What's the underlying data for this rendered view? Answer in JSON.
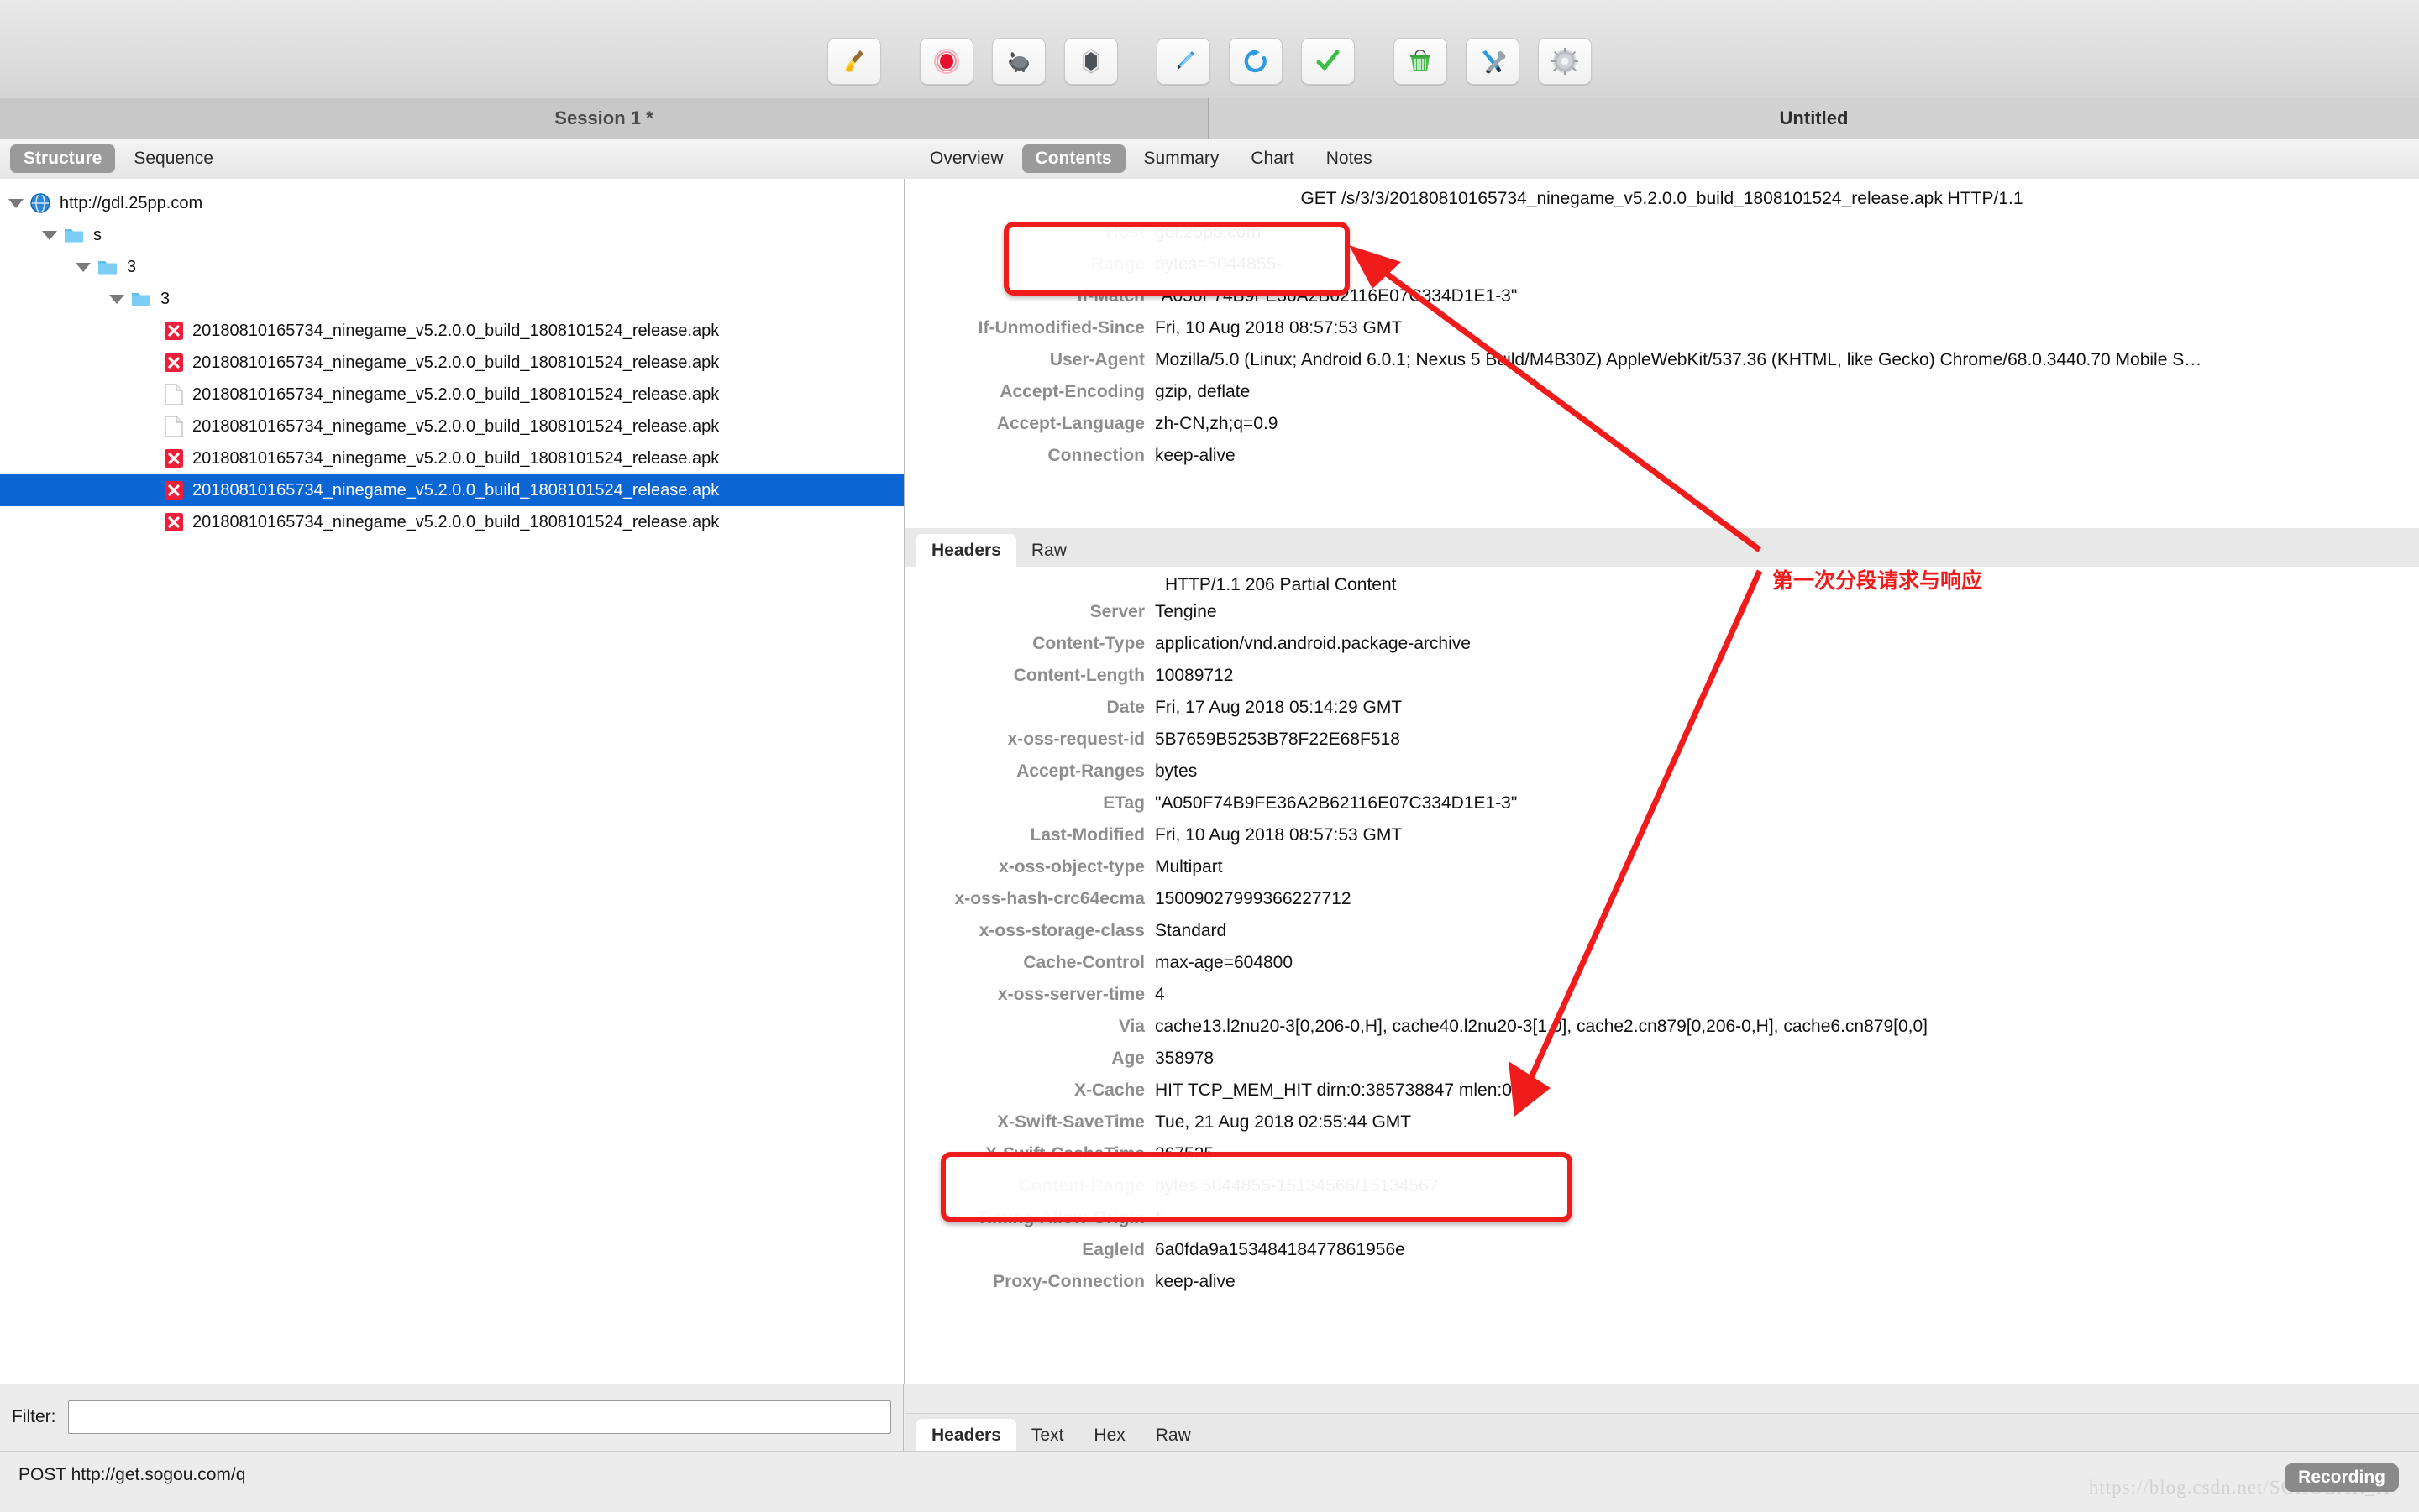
{
  "toolbar": {
    "buttons": [
      {
        "name": "clear-session-button",
        "icon": "broom-icon"
      },
      {
        "name": "record-button",
        "icon": "record-icon"
      },
      {
        "name": "throttle-button",
        "icon": "turtle-icon"
      },
      {
        "name": "breakpoints-button",
        "icon": "hexagon-icon"
      },
      {
        "name": "compose-button",
        "icon": "pen-icon"
      },
      {
        "name": "repeat-button",
        "icon": "refresh-icon"
      },
      {
        "name": "validate-button",
        "icon": "checkmark-icon"
      },
      {
        "name": "tools-basket-button",
        "icon": "trash-basket-icon"
      },
      {
        "name": "tools-button",
        "icon": "wrench-screwdriver-icon"
      },
      {
        "name": "settings-button",
        "icon": "gear-icon"
      }
    ]
  },
  "titles": {
    "session": "Session 1 *",
    "document": "Untitled"
  },
  "left_tabs": [
    {
      "label": "Structure",
      "active": true
    },
    {
      "label": "Sequence",
      "active": false
    }
  ],
  "right_tabs": [
    {
      "label": "Overview",
      "active": false
    },
    {
      "label": "Contents",
      "active": true
    },
    {
      "label": "Summary",
      "active": false
    },
    {
      "label": "Chart",
      "active": false
    },
    {
      "label": "Notes",
      "active": false
    }
  ],
  "tree": [
    {
      "label": "http://gdl.25pp.com",
      "depth": 0,
      "icon": "globe-icon",
      "expanded": true,
      "selected": false
    },
    {
      "label": "s",
      "depth": 1,
      "icon": "folder-icon",
      "expanded": true,
      "selected": false
    },
    {
      "label": "3",
      "depth": 2,
      "icon": "folder-icon",
      "expanded": true,
      "selected": false
    },
    {
      "label": "3",
      "depth": 3,
      "icon": "folder-icon",
      "expanded": true,
      "selected": false
    },
    {
      "label": "20180810165734_ninegame_v5.2.0.0_build_1808101524_release.apk",
      "depth": 4,
      "icon": "error-icon",
      "expanded": false,
      "selected": false
    },
    {
      "label": "20180810165734_ninegame_v5.2.0.0_build_1808101524_release.apk",
      "depth": 4,
      "icon": "error-icon",
      "expanded": false,
      "selected": false
    },
    {
      "label": "20180810165734_ninegame_v5.2.0.0_build_1808101524_release.apk",
      "depth": 4,
      "icon": "file-icon",
      "expanded": false,
      "selected": false
    },
    {
      "label": "20180810165734_ninegame_v5.2.0.0_build_1808101524_release.apk",
      "depth": 4,
      "icon": "file-icon",
      "expanded": false,
      "selected": false
    },
    {
      "label": "20180810165734_ninegame_v5.2.0.0_build_1808101524_release.apk",
      "depth": 4,
      "icon": "error-icon",
      "expanded": false,
      "selected": false
    },
    {
      "label": "20180810165734_ninegame_v5.2.0.0_build_1808101524_release.apk",
      "depth": 4,
      "icon": "error-icon",
      "expanded": false,
      "selected": true
    },
    {
      "label": "20180810165734_ninegame_v5.2.0.0_build_1808101524_release.apk",
      "depth": 4,
      "icon": "error-icon",
      "expanded": false,
      "selected": false
    }
  ],
  "filter": {
    "label": "Filter:",
    "value": "",
    "placeholder": ""
  },
  "request": {
    "line": "GET /s/3/3/20180810165734_ninegame_v5.2.0.0_build_1808101524_release.apk HTTP/1.1",
    "headers": [
      {
        "key": "Host",
        "value": "gdl.25pp.com"
      },
      {
        "key": "Range",
        "value": "bytes=5044855-"
      },
      {
        "key": "If-Match",
        "value": "\"A050F74B9FE36A2B62116E07C334D1E1-3\""
      },
      {
        "key": "If-Unmodified-Since",
        "value": "Fri, 10 Aug 2018 08:57:53 GMT"
      },
      {
        "key": "User-Agent",
        "value": "Mozilla/5.0 (Linux; Android 6.0.1; Nexus 5 Build/M4B30Z) AppleWebKit/537.36 (KHTML, like Gecko) Chrome/68.0.3440.70 Mobile S…"
      },
      {
        "key": "Accept-Encoding",
        "value": "gzip, deflate"
      },
      {
        "key": "Accept-Language",
        "value": "zh-CN,zh;q=0.9"
      },
      {
        "key": "Connection",
        "value": "keep-alive"
      }
    ]
  },
  "response_tabs": [
    {
      "label": "Headers",
      "active": true
    },
    {
      "label": "Raw",
      "active": false
    }
  ],
  "response": {
    "status_line": "HTTP/1.1 206 Partial Content",
    "headers": [
      {
        "key": "Server",
        "value": "Tengine"
      },
      {
        "key": "Content-Type",
        "value": "application/vnd.android.package-archive"
      },
      {
        "key": "Content-Length",
        "value": "10089712"
      },
      {
        "key": "Date",
        "value": "Fri, 17 Aug 2018 05:14:29 GMT"
      },
      {
        "key": "x-oss-request-id",
        "value": "5B7659B5253B78F22E68F518"
      },
      {
        "key": "Accept-Ranges",
        "value": "bytes"
      },
      {
        "key": "ETag",
        "value": "\"A050F74B9FE36A2B62116E07C334D1E1-3\""
      },
      {
        "key": "Last-Modified",
        "value": "Fri, 10 Aug 2018 08:57:53 GMT"
      },
      {
        "key": "x-oss-object-type",
        "value": "Multipart"
      },
      {
        "key": "x-oss-hash-crc64ecma",
        "value": "15009027999366227712"
      },
      {
        "key": "x-oss-storage-class",
        "value": "Standard"
      },
      {
        "key": "Cache-Control",
        "value": "max-age=604800"
      },
      {
        "key": "x-oss-server-time",
        "value": "4"
      },
      {
        "key": "Via",
        "value": "cache13.l2nu20-3[0,206-0,H], cache40.l2nu20-3[1,0], cache2.cn879[0,206-0,H], cache6.cn879[0,0]"
      },
      {
        "key": "Age",
        "value": "358978"
      },
      {
        "key": "X-Cache",
        "value": "HIT TCP_MEM_HIT dirn:0:385738847 mlen:0"
      },
      {
        "key": "X-Swift-SaveTime",
        "value": "Tue, 21 Aug 2018 02:55:44 GMT"
      },
      {
        "key": "X-Swift-CacheTime",
        "value": "267525"
      },
      {
        "key": "Content-Range",
        "value": "bytes 5044855-15134566/15134567"
      },
      {
        "key": "Timing-Allow-Origin",
        "value": "*"
      },
      {
        "key": "EagleId",
        "value": "6a0fda9a15348418477861956e"
      },
      {
        "key": "Proxy-Connection",
        "value": "keep-alive"
      }
    ]
  },
  "bottom_tabs": [
    {
      "label": "Headers",
      "active": true
    },
    {
      "label": "Text",
      "active": false
    },
    {
      "label": "Hex",
      "active": false
    },
    {
      "label": "Raw",
      "active": false
    }
  ],
  "statusbar": {
    "text": "POST http://get.sogou.com/q",
    "recording": "Recording",
    "watermark": "https://blog.csdn.net/SCHOLAR_II"
  },
  "annotations": {
    "note": "第一次分段请求与响应",
    "accent_color": "#f01c1c"
  }
}
